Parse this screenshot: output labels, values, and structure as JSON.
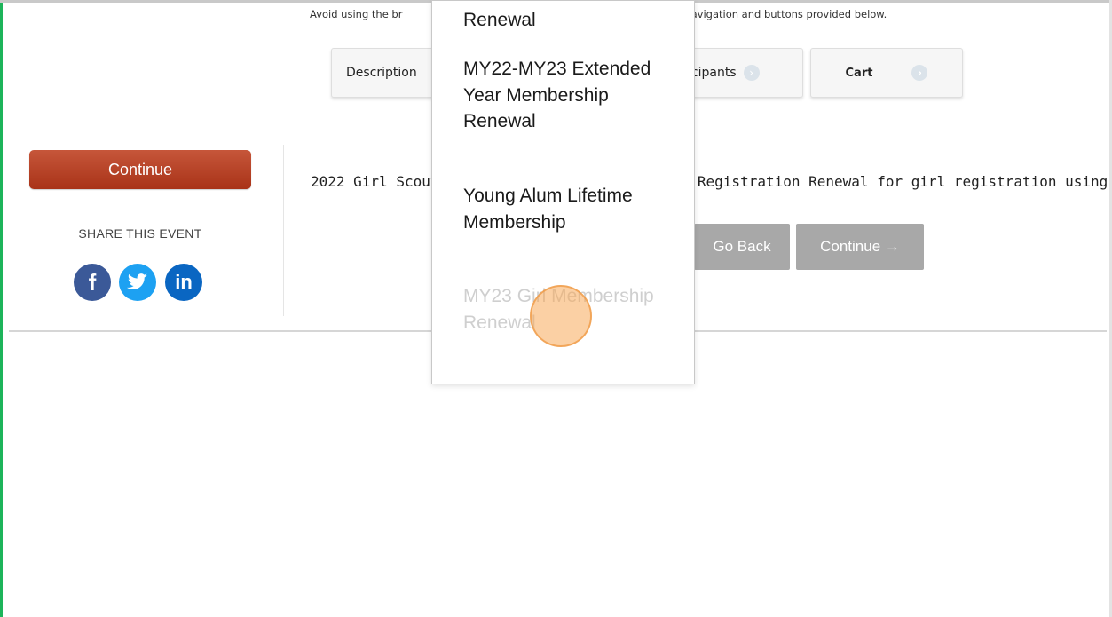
{
  "header": {
    "notice_left": "Avoid using the br",
    "notice_right": "the navigation and buttons provided below."
  },
  "steps": {
    "description": "Description",
    "participants": "icipants",
    "cart": "Cart"
  },
  "sidebar": {
    "continue_label": "Continue",
    "share_title": "SHARE THIS EVENT",
    "social": {
      "facebook": "f",
      "twitter": "t",
      "linkedin": "in"
    }
  },
  "main": {
    "description_left": "2022 Girl Scout",
    "description_right": "ip Registration Renewal for girl registration using coc",
    "go_back_label": "Go Back",
    "continue_label": "Continue →"
  },
  "dropdown": {
    "items": [
      {
        "label": "Renewal",
        "disabled": false
      },
      {
        "label": "MY22-MY23 Extended Year Membership Renewal",
        "disabled": false
      },
      {
        "label": "Young Alum Lifetime Membership",
        "disabled": false
      },
      {
        "label": "MY23 Girl Membership Renewal",
        "disabled": true
      }
    ]
  },
  "colors": {
    "primary_button": "#b5401f",
    "disabled_button": "#a8a8a8",
    "facebook": "#3b5998",
    "twitter": "#1da1f2",
    "linkedin": "#0a66c2",
    "frame_accent": "#1db45a"
  }
}
